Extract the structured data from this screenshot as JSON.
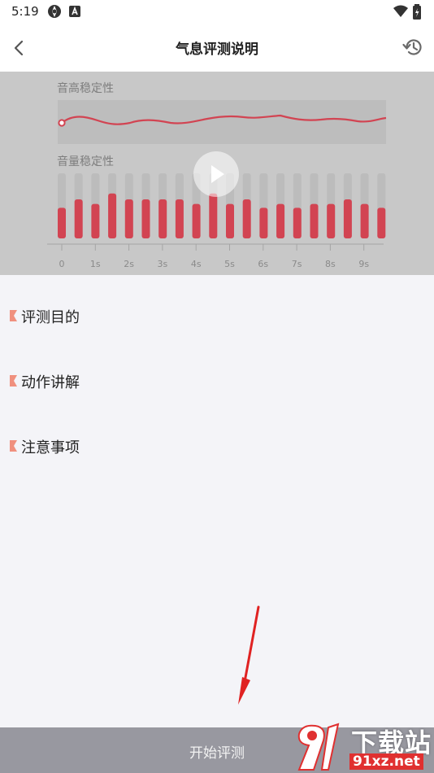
{
  "status_bar": {
    "time": "5:19",
    "icons": [
      "lens-icon",
      "a-box-icon",
      "wifi-icon",
      "battery-icon"
    ]
  },
  "header": {
    "title": "气息评测说明",
    "back_icon": "chevron-left-icon",
    "history_icon": "history-icon"
  },
  "preview": {
    "pitch_label": "音高稳定性",
    "volume_label": "音量稳定性",
    "volume_levels": [
      0.47,
      0.6,
      0.53,
      0.69,
      0.6,
      0.6,
      0.6,
      0.6,
      0.53,
      0.69,
      0.53,
      0.6,
      0.47,
      0.53,
      0.47,
      0.53,
      0.53,
      0.6,
      0.53,
      0.47
    ],
    "time_ticks": [
      "0",
      "1s",
      "2s",
      "3s",
      "4s",
      "5s",
      "6s",
      "7s",
      "8s",
      "9s"
    ],
    "play_icon": "play-icon",
    "colors": {
      "accent": "#d24452",
      "bar_track": "#bcbcbc"
    }
  },
  "sections": [
    {
      "label": "评测目的"
    },
    {
      "label": "动作讲解"
    },
    {
      "label": "注意事项"
    }
  ],
  "footer": {
    "start_label": "开始评测"
  },
  "watermark": {
    "title": "下载站",
    "url": "91xz.net"
  }
}
